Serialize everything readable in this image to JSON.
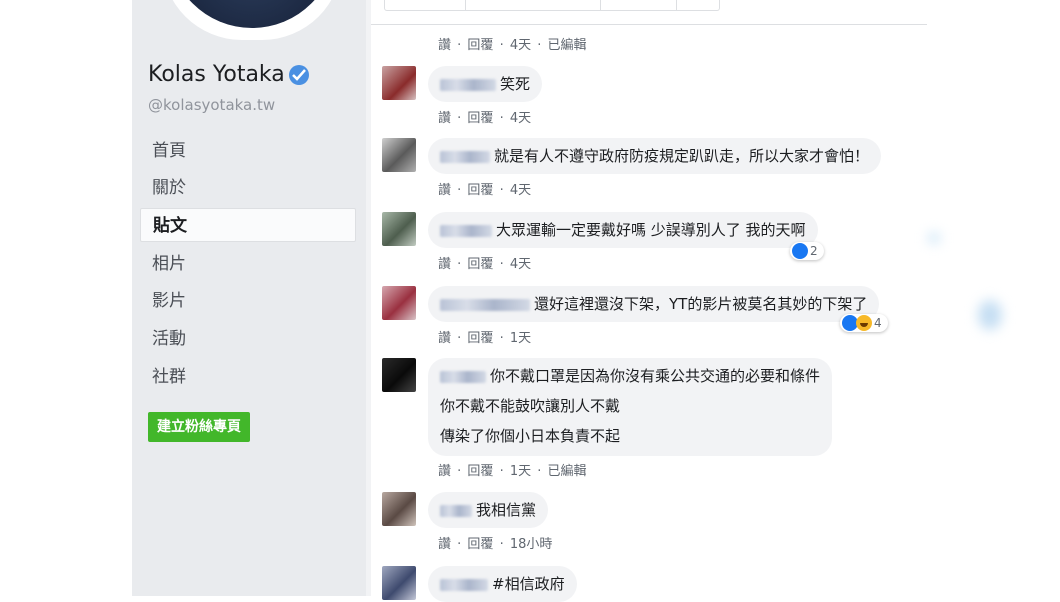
{
  "page": {
    "name": "Kolas Yotaka",
    "handle": "@kolasyotaka.tw"
  },
  "nav": [
    {
      "label": "首頁"
    },
    {
      "label": "關於"
    },
    {
      "label": "貼文",
      "active": true
    },
    {
      "label": "相片"
    },
    {
      "label": "影片"
    },
    {
      "label": "活動"
    },
    {
      "label": "社群"
    }
  ],
  "create_fan_page": "建立粉絲專頁",
  "actions": {
    "like": "讚",
    "reply": "回覆",
    "sep": " · ",
    "edited": "已編輯"
  },
  "comments": [
    {
      "id": "c0",
      "text": "",
      "time": "4天",
      "edited": true
    },
    {
      "id": "c1",
      "text": "笑死",
      "time": "4天"
    },
    {
      "id": "c2",
      "text": "就是有人不遵守政府防疫規定趴趴走，所以大家才會怕！",
      "time": "4天"
    },
    {
      "id": "c3",
      "text": "大眾運輸一定要戴好嗎 少誤導別人了 我的天啊",
      "time": "4天",
      "reactions": "2"
    },
    {
      "id": "c4",
      "text": "還好這裡還沒下架，YT的影片被莫名其妙的下架了",
      "time": "1天",
      "reactions": "4"
    },
    {
      "id": "c5",
      "lines": [
        "你不戴口罩是因為你沒有乘公共交通的必要和條件",
        "你不戴不能鼓吹讓別人不戴",
        "傳染了你個小日本負責不起"
      ],
      "time": "1天",
      "edited": true
    },
    {
      "id": "c6",
      "text": "我相信黨",
      "time": "18小時"
    },
    {
      "id": "c7",
      "text": "#相信政府"
    }
  ],
  "colors": {
    "sidebar_bg": "#e9ebee",
    "bubble_bg": "#f2f3f5",
    "verified": "#4a90e2",
    "fan_button": "#42b72a",
    "like": "#1877f2"
  }
}
